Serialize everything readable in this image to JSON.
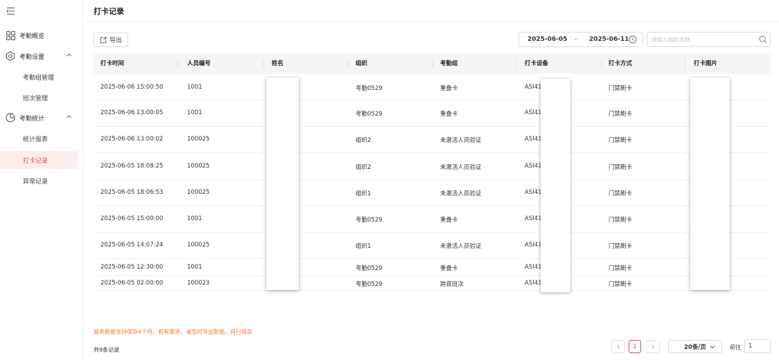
{
  "sidebar": {
    "collapse_icon": "menu-fold-icon",
    "items": [
      {
        "label": "考勤概览",
        "icon": "grid-icon"
      },
      {
        "label": "考勤设置",
        "icon": "settings-icon",
        "expanded": true
      },
      {
        "label": "考勤组管理"
      },
      {
        "label": "班次管理"
      },
      {
        "label": "考勤统计",
        "icon": "pie-chart-icon",
        "expanded": true
      },
      {
        "label": "统计报表"
      },
      {
        "label": "打卡记录",
        "active": true
      },
      {
        "label": "异常记录"
      }
    ]
  },
  "header": {
    "title": "打卡记录"
  },
  "toolbar": {
    "export_label": "导出",
    "date_start": "2025-06-05",
    "date_sep": "-",
    "date_end": "2025-06-11",
    "search_placeholder": "请输入组织名称"
  },
  "table": {
    "columns": [
      "打卡时间",
      "人员编号",
      "姓名",
      "组织",
      "考勤组",
      "打卡设备",
      "打卡方式",
      "打卡图片"
    ],
    "rows": [
      {
        "time": "2025-06-06 15:00:50",
        "id": "1001",
        "org": "考勤0529",
        "group": "重叠卡",
        "device": "ASI41(",
        "method": "门禁刷卡"
      },
      {
        "time": "2025-06-06 13:00:05",
        "id": "1001",
        "org": "考勤0529",
        "group": "重叠卡",
        "device": "ASI41(",
        "method": "门禁刷卡"
      },
      {
        "time": "2025-06-06 13:00:02",
        "id": "100025",
        "org": "组织2",
        "group": "未激活人员验证",
        "device": "ASI41(",
        "method": "门禁刷卡"
      },
      {
        "time": "2025-06-05 18:08:25",
        "id": "100025",
        "org": "组织2",
        "group": "未激活人员验证",
        "device": "ASI41(",
        "method": "门禁刷卡"
      },
      {
        "time": "2025-06-05 18:06:53",
        "id": "100025",
        "org": "组织1",
        "group": "未激活人员验证",
        "device": "ASI41(",
        "method": "门禁刷卡"
      },
      {
        "time": "2025-06-05 15:00:00",
        "id": "1001",
        "org": "考勤0529",
        "group": "重叠卡",
        "device": "ASI41(",
        "method": "门禁刷卡"
      },
      {
        "time": "2025-06-05 14:07:24",
        "id": "100025",
        "org": "组织1",
        "group": "未激活人员验证",
        "device": "ASI41(",
        "method": "门禁刷卡"
      },
      {
        "time": "2025-06-05 12:30:00",
        "id": "1001",
        "org": "考勤0529",
        "group": "重叠卡",
        "device": "ASI41(",
        "method": "门禁刷卡"
      },
      {
        "time": "2025-06-05 02:00:00",
        "id": "100023",
        "org": "考勤0529",
        "group": "跨夜班次",
        "device": "ASI41(",
        "method": "门禁刷卡"
      }
    ]
  },
  "footer": {
    "notice": "报表数据支持保存6个月，若有需求，请及时导出数据，自行保存",
    "total": "共9条记录",
    "current_page": "1",
    "page_size": "20条/页",
    "goto_label": "前往",
    "goto_value": "1"
  },
  "colors": {
    "accent": "#e8473a",
    "notice": "#f07a30",
    "active_bg": "#fdeeed"
  }
}
